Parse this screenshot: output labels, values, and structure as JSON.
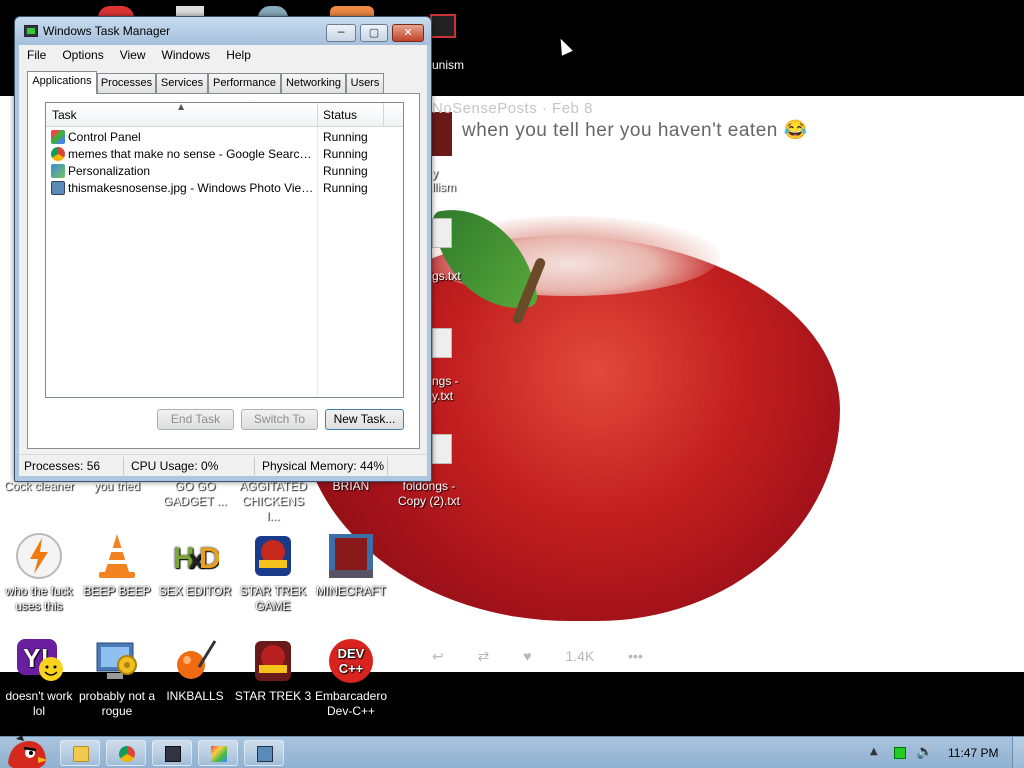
{
  "desktop": {
    "top_partial_label": "unism",
    "wallpaper": {
      "tweet_meta": "NoSensePosts · Feb 8",
      "tweet_text": "when you tell her you haven't eaten 😂",
      "tweet_reply_count": "",
      "tweet_like_count": "1.4K",
      "tweet_more": "•••"
    },
    "partial_icons": [
      {
        "label": "y"
      },
      {
        "label": "llism"
      },
      {
        "label": "gs.txt"
      },
      {
        "label": "ngs -"
      },
      {
        "label": "y.txt"
      }
    ],
    "row1_labels": [
      {
        "label": "Cock cleaner"
      },
      {
        "label": "you tried"
      },
      {
        "label": "GO GO GADGET ..."
      },
      {
        "label": "AGGITATED CHICKENS I..."
      },
      {
        "label": "BRIAN"
      },
      {
        "label": "foldongs - Copy (2).txt"
      }
    ],
    "row2_icons": [
      {
        "label": "who the fuck uses this",
        "icon": "power-lightning-icon"
      },
      {
        "label": "BEEP BEEP",
        "icon": "vlc-cone-icon"
      },
      {
        "label": "SEX EDITOR",
        "icon": "hxd-editor-icon"
      },
      {
        "label": "STAR TREK GAME",
        "icon": "star-wars-badge-icon"
      },
      {
        "label": "MINECRAFT",
        "icon": "minecraft-icon"
      }
    ],
    "row3_icons": [
      {
        "label": "doesn't work lol",
        "icon": "yahoo-messenger-icon"
      },
      {
        "label": "probably not a rogue",
        "icon": "computer-gears-icon"
      },
      {
        "label": "INKBALLS",
        "icon": "inkball-icon"
      },
      {
        "label": "STAR TREK 3",
        "icon": "star-wars-badge-icon"
      },
      {
        "label": "Embarcadero Dev-C++",
        "icon": "dev-cpp-icon"
      }
    ],
    "dev_cpp_logo": "DEV C++"
  },
  "taskmgr": {
    "title": "Windows Task Manager",
    "window_buttons": {
      "minimize": "─",
      "maximize": "▢",
      "close": "✕"
    },
    "menu": [
      "File",
      "Options",
      "View",
      "Windows",
      "Help"
    ],
    "tabs": [
      "Applications",
      "Processes",
      "Services",
      "Performance",
      "Networking",
      "Users"
    ],
    "active_tab": "Applications",
    "columns": {
      "task": "Task",
      "status": "Status"
    },
    "rows": [
      {
        "task": "Control Panel",
        "status": "Running",
        "icon": "control-panel-icon"
      },
      {
        "task": "memes that make no sense - Google Search - Go...",
        "status": "Running",
        "icon": "chrome-icon"
      },
      {
        "task": "Personalization",
        "status": "Running",
        "icon": "personalization-icon"
      },
      {
        "task": "thismakesnosense.jpg - Windows Photo Viewer",
        "status": "Running",
        "icon": "photo-viewer-icon"
      }
    ],
    "buttons": {
      "end_task": "End Task",
      "switch_to": "Switch To",
      "new_task": "New Task..."
    },
    "status": {
      "processes": "Processes: 56",
      "cpu": "CPU Usage: 0%",
      "memory": "Physical Memory: 44%"
    }
  },
  "taskbar": {
    "clock": "11:47 PM",
    "pinned": [
      "folder-icon",
      "chrome-icon",
      "task-manager-icon",
      "paint-icon",
      "photo-viewer-icon"
    ],
    "tray": [
      "show-hidden-icons-icon",
      "network-icon",
      "volume-icon"
    ]
  }
}
